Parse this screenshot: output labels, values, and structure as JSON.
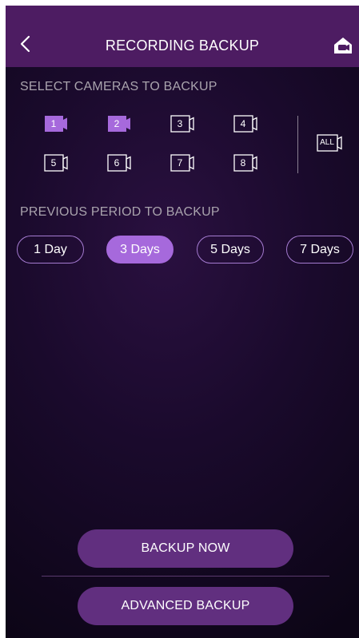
{
  "header": {
    "title": "RECORDING BACKUP",
    "back_icon": "chevron-left-icon",
    "home_icon": "home-camera-icon"
  },
  "cameras": {
    "label": "SELECT CAMERAS TO BACKUP",
    "items": [
      {
        "label": "1",
        "selected": true
      },
      {
        "label": "2",
        "selected": true
      },
      {
        "label": "3",
        "selected": false
      },
      {
        "label": "4",
        "selected": false
      },
      {
        "label": "5",
        "selected": false
      },
      {
        "label": "6",
        "selected": false
      },
      {
        "label": "7",
        "selected": false
      },
      {
        "label": "8",
        "selected": false
      }
    ],
    "all_label": "ALL"
  },
  "period": {
    "label": "PREVIOUS PERIOD TO BACKUP",
    "options": [
      {
        "label": "1 Day",
        "selected": false
      },
      {
        "label": "3 Days",
        "selected": true
      },
      {
        "label": "5 Days",
        "selected": false
      },
      {
        "label": "7 Days",
        "selected": false
      }
    ]
  },
  "actions": {
    "backup_now": "BACKUP NOW",
    "advanced_backup": "ADVANCED BACKUP"
  },
  "colors": {
    "header_bg": "#4d1c62",
    "accent": "#a669dc",
    "button_bg": "#612f7f"
  }
}
